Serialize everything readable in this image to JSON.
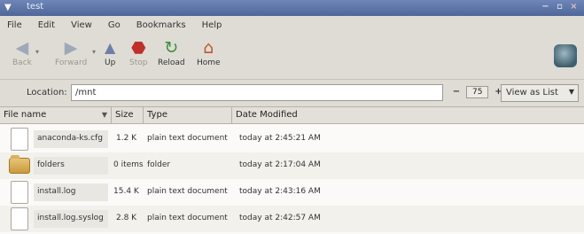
{
  "window": {
    "title": "test",
    "controls": [
      "−",
      "▫",
      "×"
    ]
  },
  "menu": [
    "File",
    "Edit",
    "View",
    "Go",
    "Bookmarks",
    "Help"
  ],
  "toolbar": {
    "back": "Back",
    "forward": "Forward",
    "up": "Up",
    "stop": "Stop",
    "reload": "Reload",
    "home": "Home"
  },
  "location": {
    "label": "Location:",
    "value": "/mnt"
  },
  "zoom": {
    "minus": "−",
    "value": "75",
    "plus": "+"
  },
  "view_select": {
    "value": "View as List"
  },
  "columns": {
    "name": "File name",
    "size": "Size",
    "type": "Type",
    "date": "Date Modified"
  },
  "files": [
    {
      "name": "anaconda-ks.cfg",
      "size": "1.2 K",
      "type": "plain text document",
      "date": "today at 2:45:21 AM",
      "kind": "file"
    },
    {
      "name": "folders",
      "size": "0 items",
      "type": "folder",
      "date": "today at 2:17:04 AM",
      "kind": "folder"
    },
    {
      "name": "install.log",
      "size": "15.4 K",
      "type": "plain text document",
      "date": "today at 2:43:16 AM",
      "kind": "file"
    },
    {
      "name": "install.log.syslog",
      "size": "2.8 K",
      "type": "plain text document",
      "date": "today at 2:42:57 AM",
      "kind": "file"
    }
  ],
  "colors": {
    "titlebar": "#5a72a8",
    "background": "#d8d6cf",
    "stop_icon": "#c0302a",
    "home_icon": "#c0582a",
    "reload_icon": "#3f8f3a"
  }
}
